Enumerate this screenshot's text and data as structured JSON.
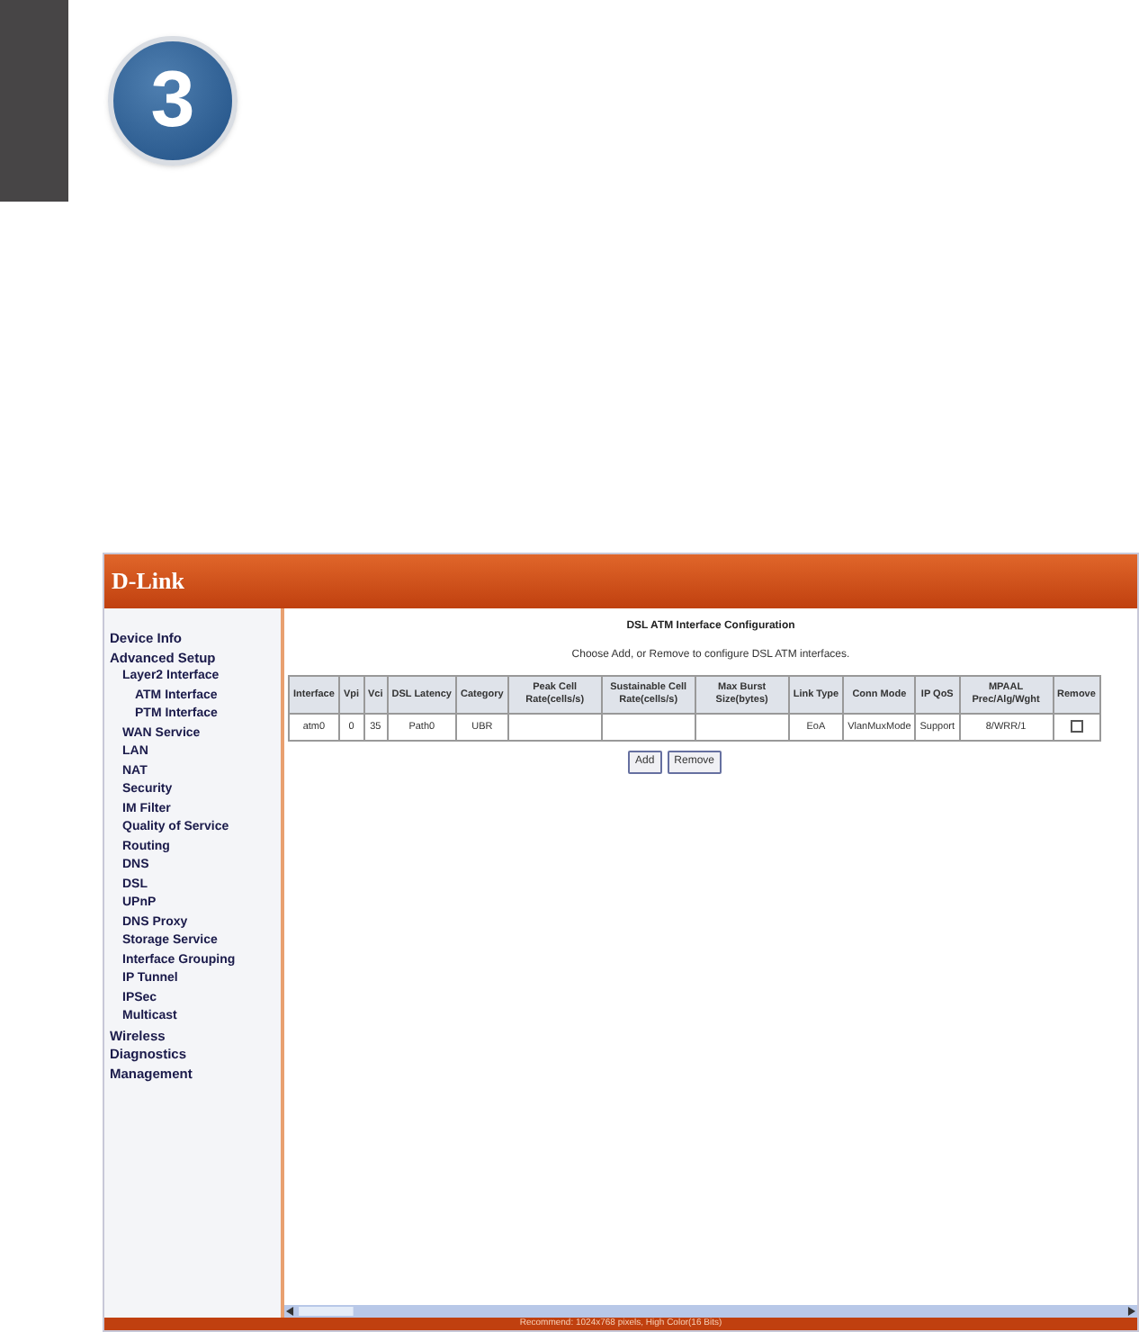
{
  "step": {
    "number": "3"
  },
  "screenshot": {
    "brand": "D-Link",
    "sidebar": {
      "items": [
        {
          "label": "Device Info"
        },
        {
          "label": "Advanced Setup",
          "children": [
            {
              "label": "Layer2 Interface",
              "children": [
                {
                  "label": "ATM Interface"
                },
                {
                  "label": "PTM Interface"
                }
              ]
            },
            {
              "label": "WAN Service"
            },
            {
              "label": "LAN"
            },
            {
              "label": "NAT"
            },
            {
              "label": "Security"
            },
            {
              "label": "IM Filter"
            },
            {
              "label": "Quality of Service"
            },
            {
              "label": "Routing"
            },
            {
              "label": "DNS"
            },
            {
              "label": "DSL"
            },
            {
              "label": "UPnP"
            },
            {
              "label": "DNS Proxy"
            },
            {
              "label": "Storage Service"
            },
            {
              "label": "Interface Grouping"
            },
            {
              "label": "IP Tunnel"
            },
            {
              "label": "IPSec"
            },
            {
              "label": "Multicast"
            }
          ]
        },
        {
          "label": "Wireless"
        },
        {
          "label": "Diagnostics"
        },
        {
          "label": "Management"
        }
      ]
    },
    "content": {
      "title": "DSL ATM Interface Configuration",
      "subtitle": "Choose Add, or Remove to configure DSL ATM interfaces.",
      "table": {
        "columns": [
          "Interface",
          "Vpi",
          "Vci",
          "DSL Latency",
          "Category",
          "Peak Cell Rate(cells/s)",
          "Sustainable Cell Rate(cells/s)",
          "Max Burst Size(bytes)",
          "Link Type",
          "Conn Mode",
          "IP QoS",
          "MPAAL Prec/Alg/Wght",
          "Remove"
        ],
        "rows": [
          {
            "cells": [
              "atm0",
              "0",
              "35",
              "Path0",
              "UBR",
              "",
              "",
              "",
              "EoA",
              "VlanMuxMode",
              "Support",
              "8/WRR/1"
            ],
            "remove_checked": false
          }
        ]
      },
      "buttons": [
        "Add",
        "Remove"
      ]
    },
    "footer": "Recommend: 1024x768 pixels, High Color(16 Bits)"
  }
}
